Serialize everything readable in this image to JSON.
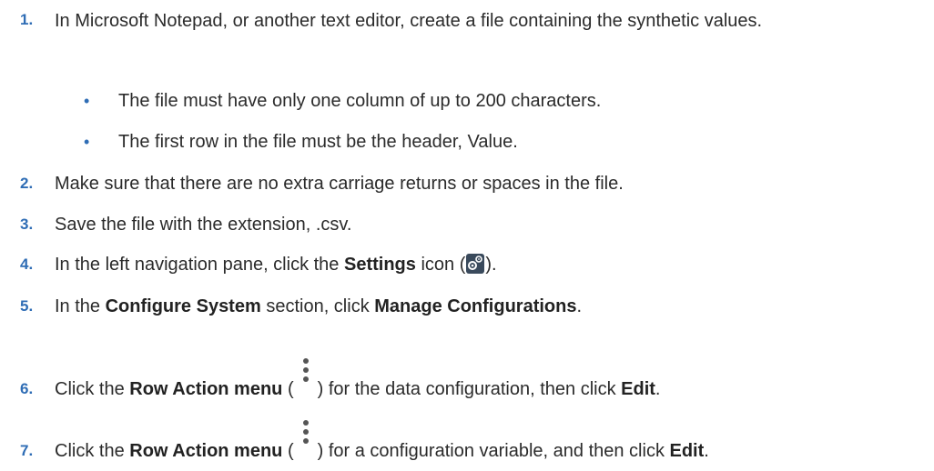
{
  "steps": [
    {
      "number": "1.",
      "text": "In Microsoft Notepad, or another text editor, create a file containing the synthetic values.",
      "bullets": [
        "The file must have only one column of up to 200 characters.",
        "The first row in the file must be the header, Value."
      ]
    },
    {
      "number": "2.",
      "text": "Make sure that there are no extra carriage returns or spaces in the file."
    },
    {
      "number": "3.",
      "text": "Save the file with the extension, .csv."
    },
    {
      "number": "4.",
      "pre": "In the left navigation pane, click the ",
      "bold": "Settings",
      "mid": " icon (",
      "icon": "settings-gear-icon",
      "post": ")."
    },
    {
      "number": "5.",
      "pre": "In the ",
      "bold1": "Configure System",
      "mid": " section, click ",
      "bold2": "Manage Configurations",
      "post": "."
    },
    {
      "number": "6.",
      "pre": "Click the ",
      "bold1": "Row Action menu",
      "open": " (",
      "icon": "kebab-menu-icon",
      "mid": ") for the data configuration, then click ",
      "bold2": "Edit",
      "post": "."
    },
    {
      "number": "7.",
      "pre": "Click the ",
      "bold1": "Row Action menu",
      "open": " (",
      "icon": "kebab-menu-icon",
      "mid": ") for a configuration variable, and then click ",
      "bold2": "Edit",
      "post": "."
    }
  ],
  "colors": {
    "step_number": "#2f6db5",
    "text": "#2b2b2b",
    "icon_bg": "#3a4a5c"
  }
}
